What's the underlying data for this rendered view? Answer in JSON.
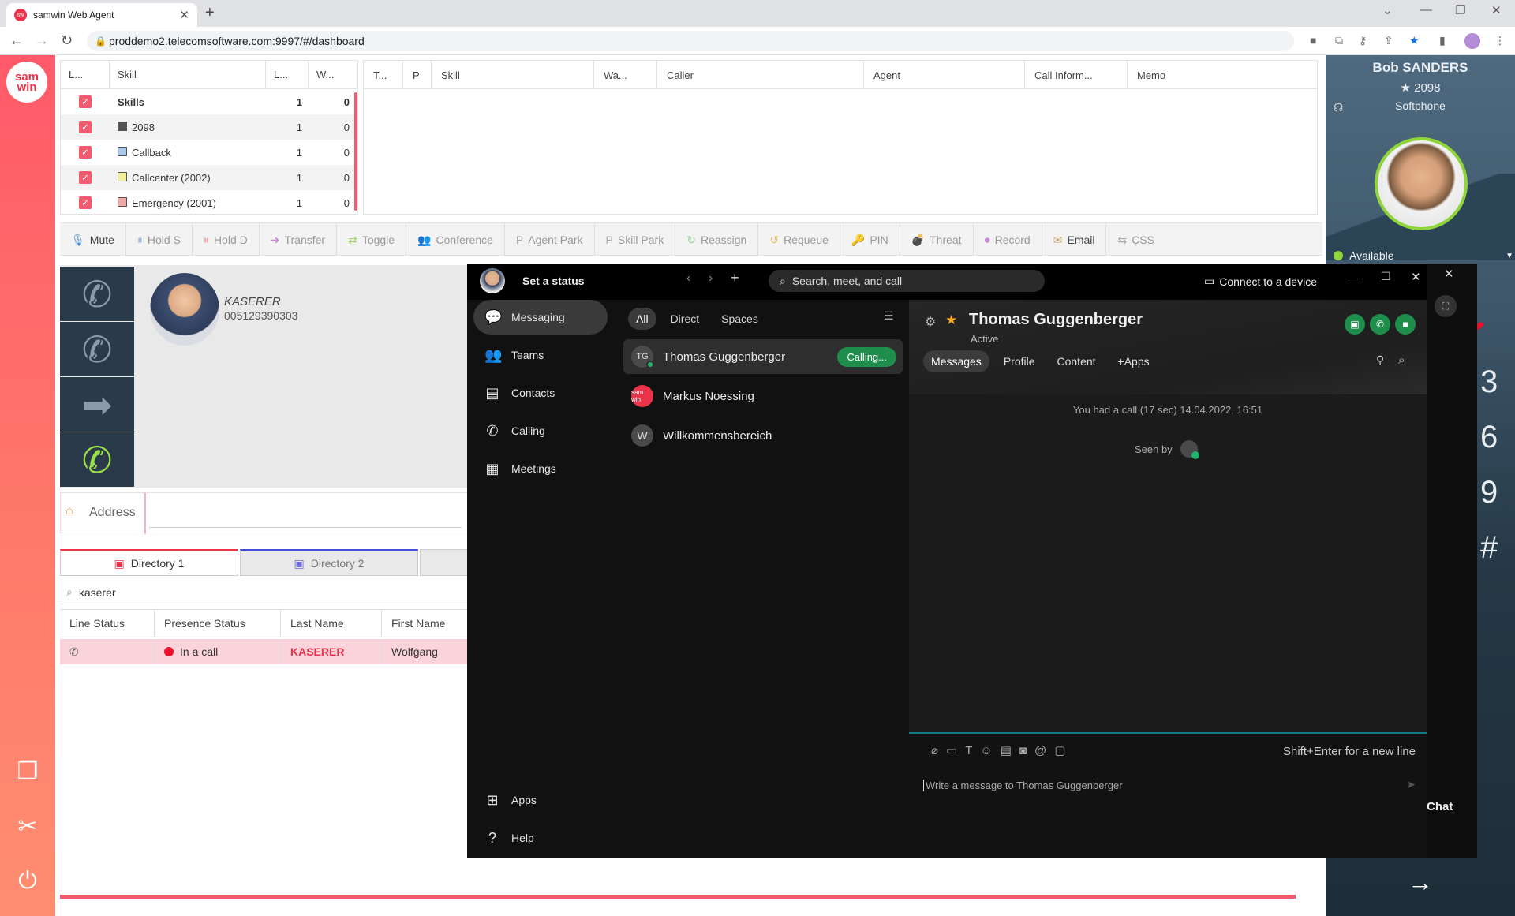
{
  "browser": {
    "tab_title": "samwin Web Agent",
    "url": "proddemo2.telecomsoftware.com:9997/#/dashboard"
  },
  "app": {
    "logo_text": "sam win"
  },
  "skills_table": {
    "headers": [
      "L...",
      "Skill",
      "L...",
      "W..."
    ],
    "rows": [
      {
        "skill": "Skills",
        "l": "1",
        "w": "0",
        "color": ""
      },
      {
        "skill": "2098",
        "l": "1",
        "w": "0",
        "color": "#555555"
      },
      {
        "skill": "Callback",
        "l": "1",
        "w": "0",
        "color": "#a9c8ea"
      },
      {
        "skill": "Callcenter (2002)",
        "l": "1",
        "w": "0",
        "color": "#f4ef9a"
      },
      {
        "skill": "Emergency (2001)",
        "l": "1",
        "w": "0",
        "color": "#f2a7a7"
      }
    ]
  },
  "calls_table": {
    "headers": [
      "T...",
      "P",
      "Skill",
      "Wa...",
      "Caller",
      "Agent",
      "Call Inform...",
      "Memo"
    ]
  },
  "toolbar": {
    "items": [
      {
        "label": "Mute",
        "icon": "🎙"
      },
      {
        "label": "Hold S",
        "icon": "⏸"
      },
      {
        "label": "Hold D",
        "icon": "⏸"
      },
      {
        "label": "Transfer",
        "icon": "➜"
      },
      {
        "label": "Toggle",
        "icon": "⇄"
      },
      {
        "label": "Conference",
        "icon": "👥"
      },
      {
        "label": "Agent Park",
        "icon": "P"
      },
      {
        "label": "Skill Park",
        "icon": "P"
      },
      {
        "label": "Reassign",
        "icon": "↻"
      },
      {
        "label": "Requeue",
        "icon": "↺"
      },
      {
        "label": "PIN",
        "icon": "🔑"
      },
      {
        "label": "Threat",
        "icon": "💣"
      },
      {
        "label": "Record",
        "icon": "⏺"
      },
      {
        "label": "Email",
        "icon": "✉"
      },
      {
        "label": "CSS",
        "icon": "⇆"
      }
    ]
  },
  "caller": {
    "name": "KASERER",
    "number": "005129390303"
  },
  "address": {
    "label": "Address",
    "value": ""
  },
  "directory": {
    "tab1": "Directory 1",
    "tab2": "Directory 2",
    "search": "kaserer",
    "headers": [
      "Line Status",
      "Presence Status",
      "Last Name",
      "First Name"
    ],
    "row": {
      "presence": "In a call",
      "last": "KASERER",
      "first": "Wolfgang"
    }
  },
  "profile": {
    "name": "Bob SANDERS",
    "extension": "2098",
    "device": "Softphone",
    "status": "Available",
    "digits": [
      "3",
      "6",
      "9",
      "#"
    ],
    "chat_label": "Chat"
  },
  "webex": {
    "set_status": "Set a status",
    "search_placeholder": "Search, meet, and call",
    "connect_device": "Connect to a device",
    "nav": [
      "Messaging",
      "Teams",
      "Contacts",
      "Calling",
      "Meetings"
    ],
    "nav_bottom": [
      "Apps",
      "Help"
    ],
    "filters": [
      "All",
      "Direct",
      "Spaces"
    ],
    "spaces": [
      {
        "initials": "TG",
        "name": "Thomas Guggenberger",
        "badge": "Calling..."
      },
      {
        "initials": "sam win",
        "name": "Markus Noessing",
        "badge": ""
      },
      {
        "initials": "W",
        "name": "Willkommensbereich",
        "badge": ""
      }
    ],
    "conversation": {
      "title": "Thomas Guggenberger",
      "status": "Active",
      "tabs": [
        "Messages",
        "Profile",
        "Content",
        "+Apps"
      ],
      "call_notice": "You had a call (17 sec) 14.04.2022, 16:51",
      "seen_by": "Seen by",
      "hint": "Shift+Enter for a new line",
      "compose_placeholder": "Write a message to Thomas Guggenberger"
    }
  }
}
